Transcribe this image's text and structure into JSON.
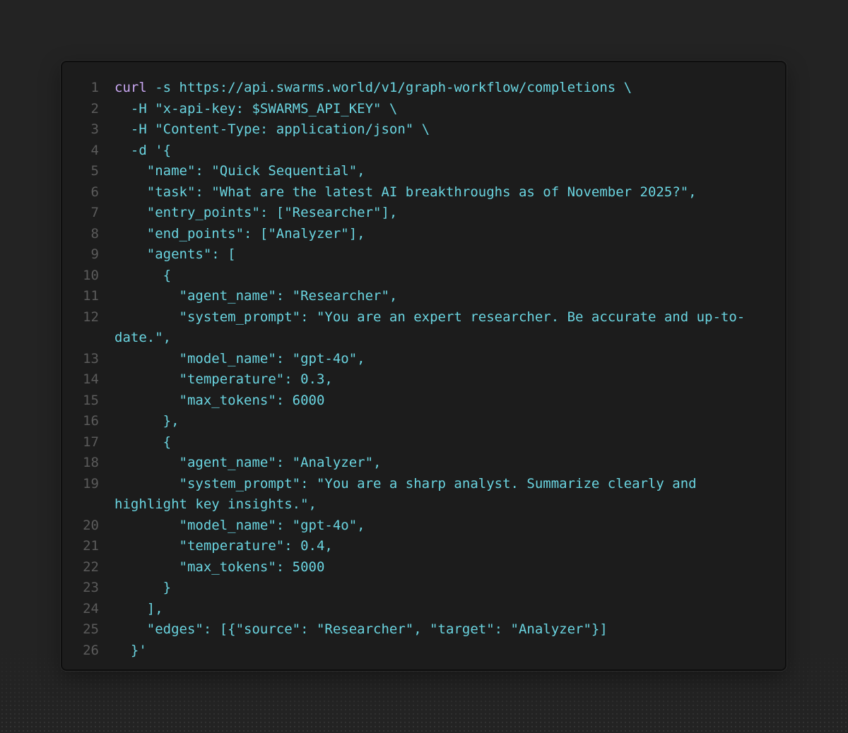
{
  "code_block": {
    "language": "bash",
    "lines": [
      {
        "number": "1",
        "command": "curl",
        "text": " -s https://api.swarms.world/v1/graph-workflow/completions \\"
      },
      {
        "number": "2",
        "text": "  -H \"x-api-key: $SWARMS_API_KEY\" \\"
      },
      {
        "number": "3",
        "text": "  -H \"Content-Type: application/json\" \\"
      },
      {
        "number": "4",
        "text": "  -d '{"
      },
      {
        "number": "5",
        "text": "    \"name\": \"Quick Sequential\","
      },
      {
        "number": "6",
        "text": "    \"task\": \"What are the latest AI breakthroughs as of November 2025?\","
      },
      {
        "number": "7",
        "text": "    \"entry_points\": [\"Researcher\"],"
      },
      {
        "number": "8",
        "text": "    \"end_points\": [\"Analyzer\"],"
      },
      {
        "number": "9",
        "text": "    \"agents\": ["
      },
      {
        "number": "10",
        "text": "      {"
      },
      {
        "number": "11",
        "text": "        \"agent_name\": \"Researcher\","
      },
      {
        "number": "12",
        "text": "        \"system_prompt\": \"You are an expert researcher. Be accurate and up-to-"
      },
      {
        "number": "",
        "text": "date.\","
      },
      {
        "number": "13",
        "text": "        \"model_name\": \"gpt-4o\","
      },
      {
        "number": "14",
        "text": "        \"temperature\": 0.3,"
      },
      {
        "number": "15",
        "text": "        \"max_tokens\": 6000"
      },
      {
        "number": "16",
        "text": "      },"
      },
      {
        "number": "17",
        "text": "      {"
      },
      {
        "number": "18",
        "text": "        \"agent_name\": \"Analyzer\","
      },
      {
        "number": "19",
        "text": "        \"system_prompt\": \"You are a sharp analyst. Summarize clearly and"
      },
      {
        "number": "",
        "text": "highlight key insights.\","
      },
      {
        "number": "20",
        "text": "        \"model_name\": \"gpt-4o\","
      },
      {
        "number": "21",
        "text": "        \"temperature\": 0.4,"
      },
      {
        "number": "22",
        "text": "        \"max_tokens\": 5000"
      },
      {
        "number": "23",
        "text": "      }"
      },
      {
        "number": "24",
        "text": "    ],"
      },
      {
        "number": "25",
        "text": "    \"edges\": [{\"source\": \"Researcher\", \"target\": \"Analyzer\"}]"
      },
      {
        "number": "26",
        "text": "  }'"
      }
    ]
  },
  "colors": {
    "page_background": "#232323",
    "code_background": "#1c1c1c",
    "code_text": "#6ad4e0",
    "command_text": "#c9a7f2",
    "line_numbers": "#5b5b5b"
  }
}
